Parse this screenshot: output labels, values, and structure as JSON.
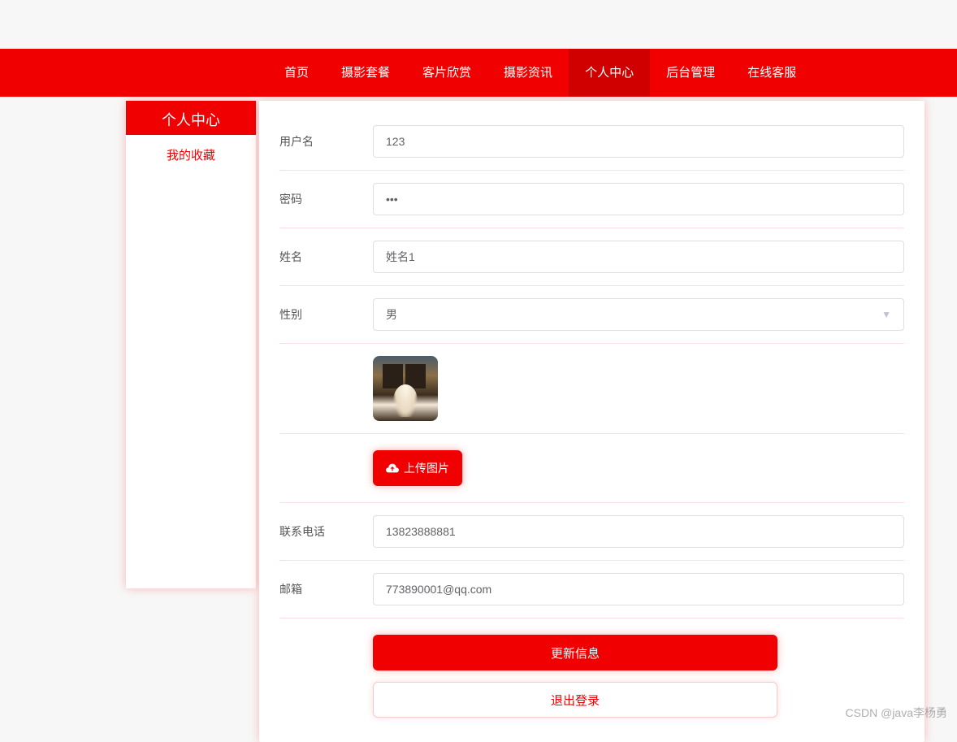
{
  "nav": {
    "items": [
      {
        "label": "首页",
        "active": false
      },
      {
        "label": "摄影套餐",
        "active": false
      },
      {
        "label": "客片欣赏",
        "active": false
      },
      {
        "label": "摄影资讯",
        "active": false
      },
      {
        "label": "个人中心",
        "active": true
      },
      {
        "label": "后台管理",
        "active": false
      },
      {
        "label": "在线客服",
        "active": false
      }
    ]
  },
  "sidebar": {
    "title": "个人中心",
    "items": [
      {
        "label": "我的收藏"
      }
    ]
  },
  "form": {
    "username": {
      "label": "用户名",
      "value": "123"
    },
    "password": {
      "label": "密码",
      "value": "•••"
    },
    "name": {
      "label": "姓名",
      "value": "姓名1"
    },
    "gender": {
      "label": "性别",
      "value": "男"
    },
    "upload": {
      "label": "上传图片"
    },
    "phone": {
      "label": "联系电话",
      "value": "13823888881"
    },
    "email": {
      "label": "邮箱",
      "value": "773890001@qq.com"
    }
  },
  "actions": {
    "update": "更新信息",
    "logout": "退出登录"
  },
  "watermark": "CSDN @java李杨勇"
}
